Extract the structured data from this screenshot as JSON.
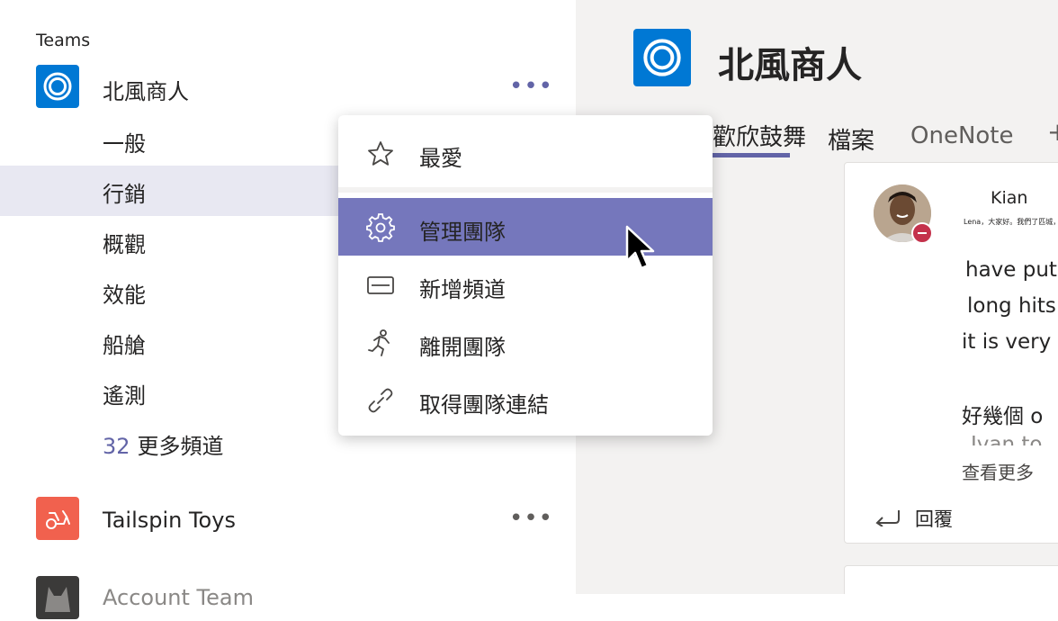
{
  "sidebar": {
    "heading": "Teams",
    "teams": [
      {
        "name": "北風商人",
        "more": "•••"
      },
      {
        "name": "Tailspin Toys",
        "more": "•••"
      },
      {
        "name": "Account Team"
      }
    ],
    "channels": [
      {
        "label": "一般"
      },
      {
        "label": "行銷"
      },
      {
        "label": "概觀"
      },
      {
        "label": "效能"
      },
      {
        "label": "船艙"
      },
      {
        "label": "遙測"
      }
    ],
    "more_channels": {
      "count": "32",
      "label": "更多頻道"
    }
  },
  "context_menu": {
    "items": [
      {
        "label": "最愛",
        "icon": "star-icon"
      },
      {
        "label": "管理團隊",
        "icon": "gear-icon"
      },
      {
        "label": "新增頻道",
        "icon": "channel-icon"
      },
      {
        "label": "離開團隊",
        "icon": "leave-icon"
      },
      {
        "label": "取得團隊連結",
        "icon": "link-icon"
      }
    ]
  },
  "header": {
    "title": "北風商人",
    "tabs": [
      {
        "label": "歡欣鼓舞"
      },
      {
        "label": "檔案"
      },
      {
        "label": "OneNote"
      }
    ],
    "add_tab": "+"
  },
  "post": {
    "author": "Kian",
    "tiny_text": "Lena，大家好。我們了匹城，暴幾",
    "lines": [
      "have put",
      "long hits",
      "it is very",
      "好幾個 o",
      "Ivan to"
    ],
    "see_more": "查看更多",
    "reply_label": "回覆"
  },
  "colors": {
    "accent": "#6264a7",
    "menu_highlight": "#7577bc",
    "team_blue": "#0078d4",
    "team_coral": "#f1614e"
  }
}
